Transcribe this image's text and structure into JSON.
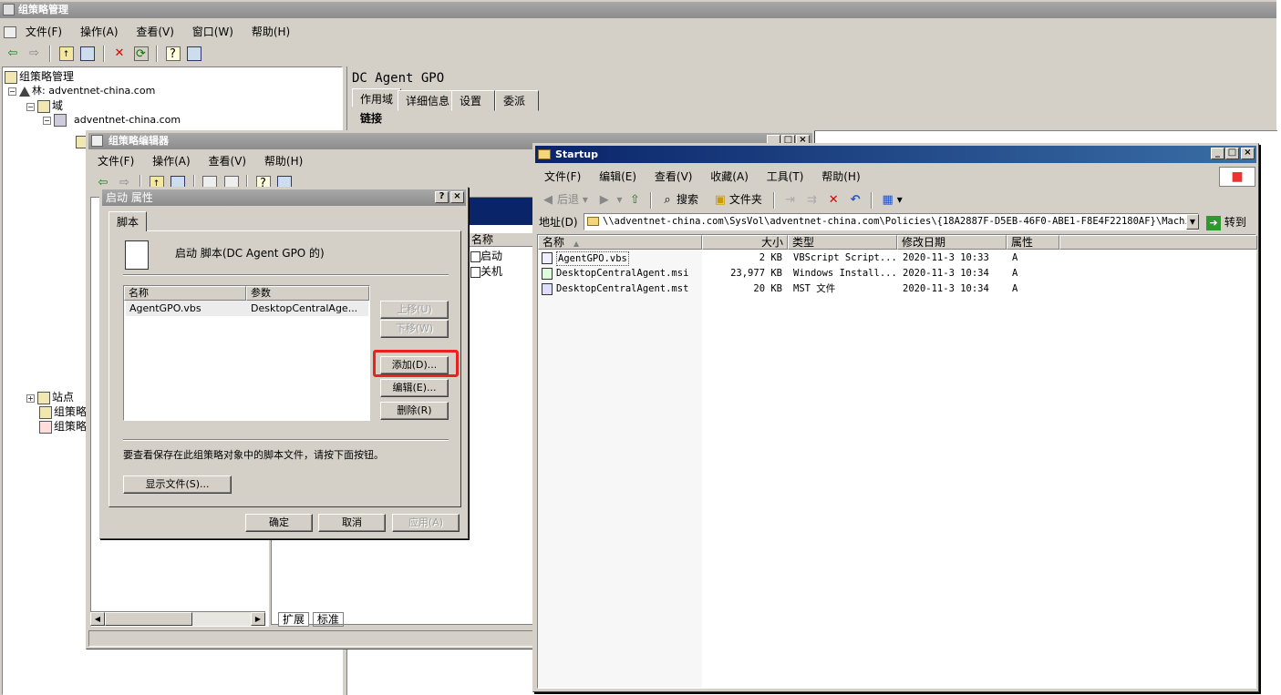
{
  "main": {
    "title": "组策略管理",
    "menu": [
      "文件(F)",
      "操作(A)",
      "查看(V)",
      "窗口(W)",
      "帮助(H)"
    ],
    "tree": {
      "root": "组策略管理",
      "forest": "林: adventnet-china.com",
      "domains": "域",
      "domain": "adventnet-china.com",
      "sites": "站点",
      "gpm1": "组策略",
      "gpm2": "组策略"
    },
    "right_title": "DC Agent GPO",
    "tabs": [
      "作用域",
      "详细信息",
      "设置",
      "委派"
    ],
    "links_label": "链接"
  },
  "gpe": {
    "title": "组策略编辑器",
    "menu": [
      "文件(F)",
      "操作(A)",
      "查看(V)",
      "帮助(H)"
    ],
    "col_name": "名称",
    "items": [
      "启动",
      "关机"
    ],
    "bottom_tabs": [
      "扩展",
      "标准"
    ]
  },
  "dialog": {
    "title": "启动 属性",
    "tab": "脚本",
    "desc": "启动 脚本(DC Agent GPO 的)",
    "col_name": "名称",
    "col_param": "参数",
    "row_name": "AgentGPO.vbs",
    "row_param": "DesktopCentralAge...",
    "btn_up": "上移(U)",
    "btn_down": "下移(W)",
    "btn_add": "添加(D)...",
    "btn_edit": "编辑(E)...",
    "btn_remove": "删除(R)",
    "hint": "要查看保存在此组策略对象中的脚本文件，请按下面按钮。",
    "btn_show": "显示文件(S)...",
    "btn_ok": "确定",
    "btn_cancel": "取消",
    "btn_apply": "应用(A)",
    "highlight_color": "#e8231f"
  },
  "explorer": {
    "title": "Startup",
    "menu": [
      "文件(F)",
      "编辑(E)",
      "查看(V)",
      "收藏(A)",
      "工具(T)",
      "帮助(H)"
    ],
    "back": "后退",
    "search": "搜索",
    "folders": "文件夹",
    "address_label": "地址(D)",
    "address": "\\\\adventnet-china.com\\SysVol\\adventnet-china.com\\Policies\\{18A2887F-D5EB-46F0-ABE1-F8E4F22180AF}\\Machine\\S",
    "go": "转到",
    "columns": {
      "name": "名称",
      "size": "大小",
      "type": "类型",
      "date": "修改日期",
      "attr": "属性"
    },
    "files": [
      {
        "name": "AgentGPO.vbs",
        "size": "2 KB",
        "type": "VBScript Script...",
        "date": "2020-11-3 10:33",
        "attr": "A"
      },
      {
        "name": "DesktopCentralAgent.msi",
        "size": "23,977 KB",
        "type": "Windows Install...",
        "date": "2020-11-3 10:34",
        "attr": "A"
      },
      {
        "name": "DesktopCentralAgent.mst",
        "size": "20 KB",
        "type": "MST 文件",
        "date": "2020-11-3 10:34",
        "attr": "A"
      }
    ]
  }
}
